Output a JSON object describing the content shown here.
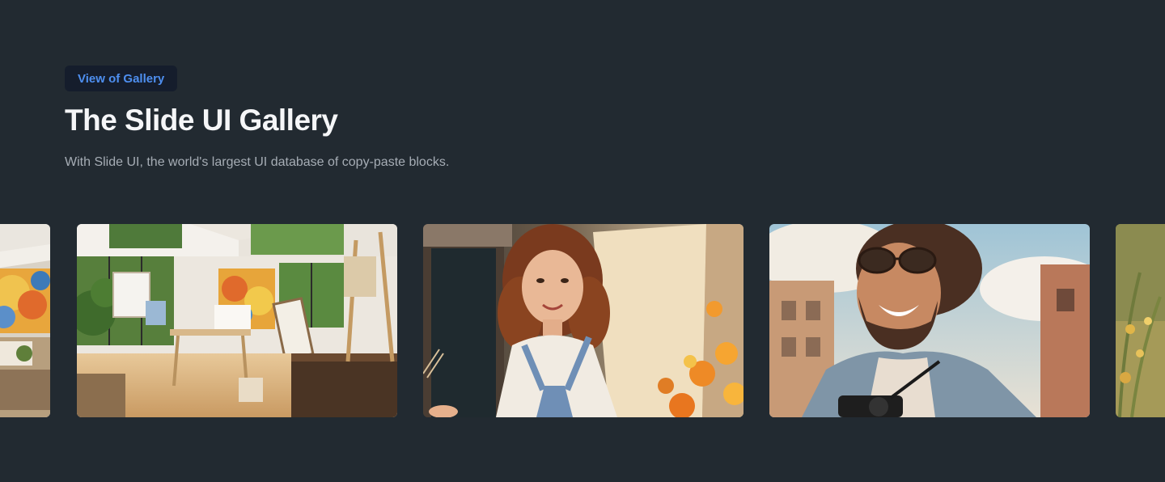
{
  "hero": {
    "badge_label": "View of Gallery",
    "title": "The Slide UI Gallery",
    "subtitle": "With Slide UI, the world's largest UI database of copy-paste blocks."
  },
  "gallery": {
    "images": [
      {
        "subject": "art studio with colorful painting (cropped)"
      },
      {
        "subject": "bright art studio with easels and large windows"
      },
      {
        "subject": "smiling young woman in overalls painting a canvas with flowers"
      },
      {
        "subject": "smiling bearded man with sunglasses and camera"
      },
      {
        "subject": "yellow foliage (cropped)"
      }
    ]
  }
}
